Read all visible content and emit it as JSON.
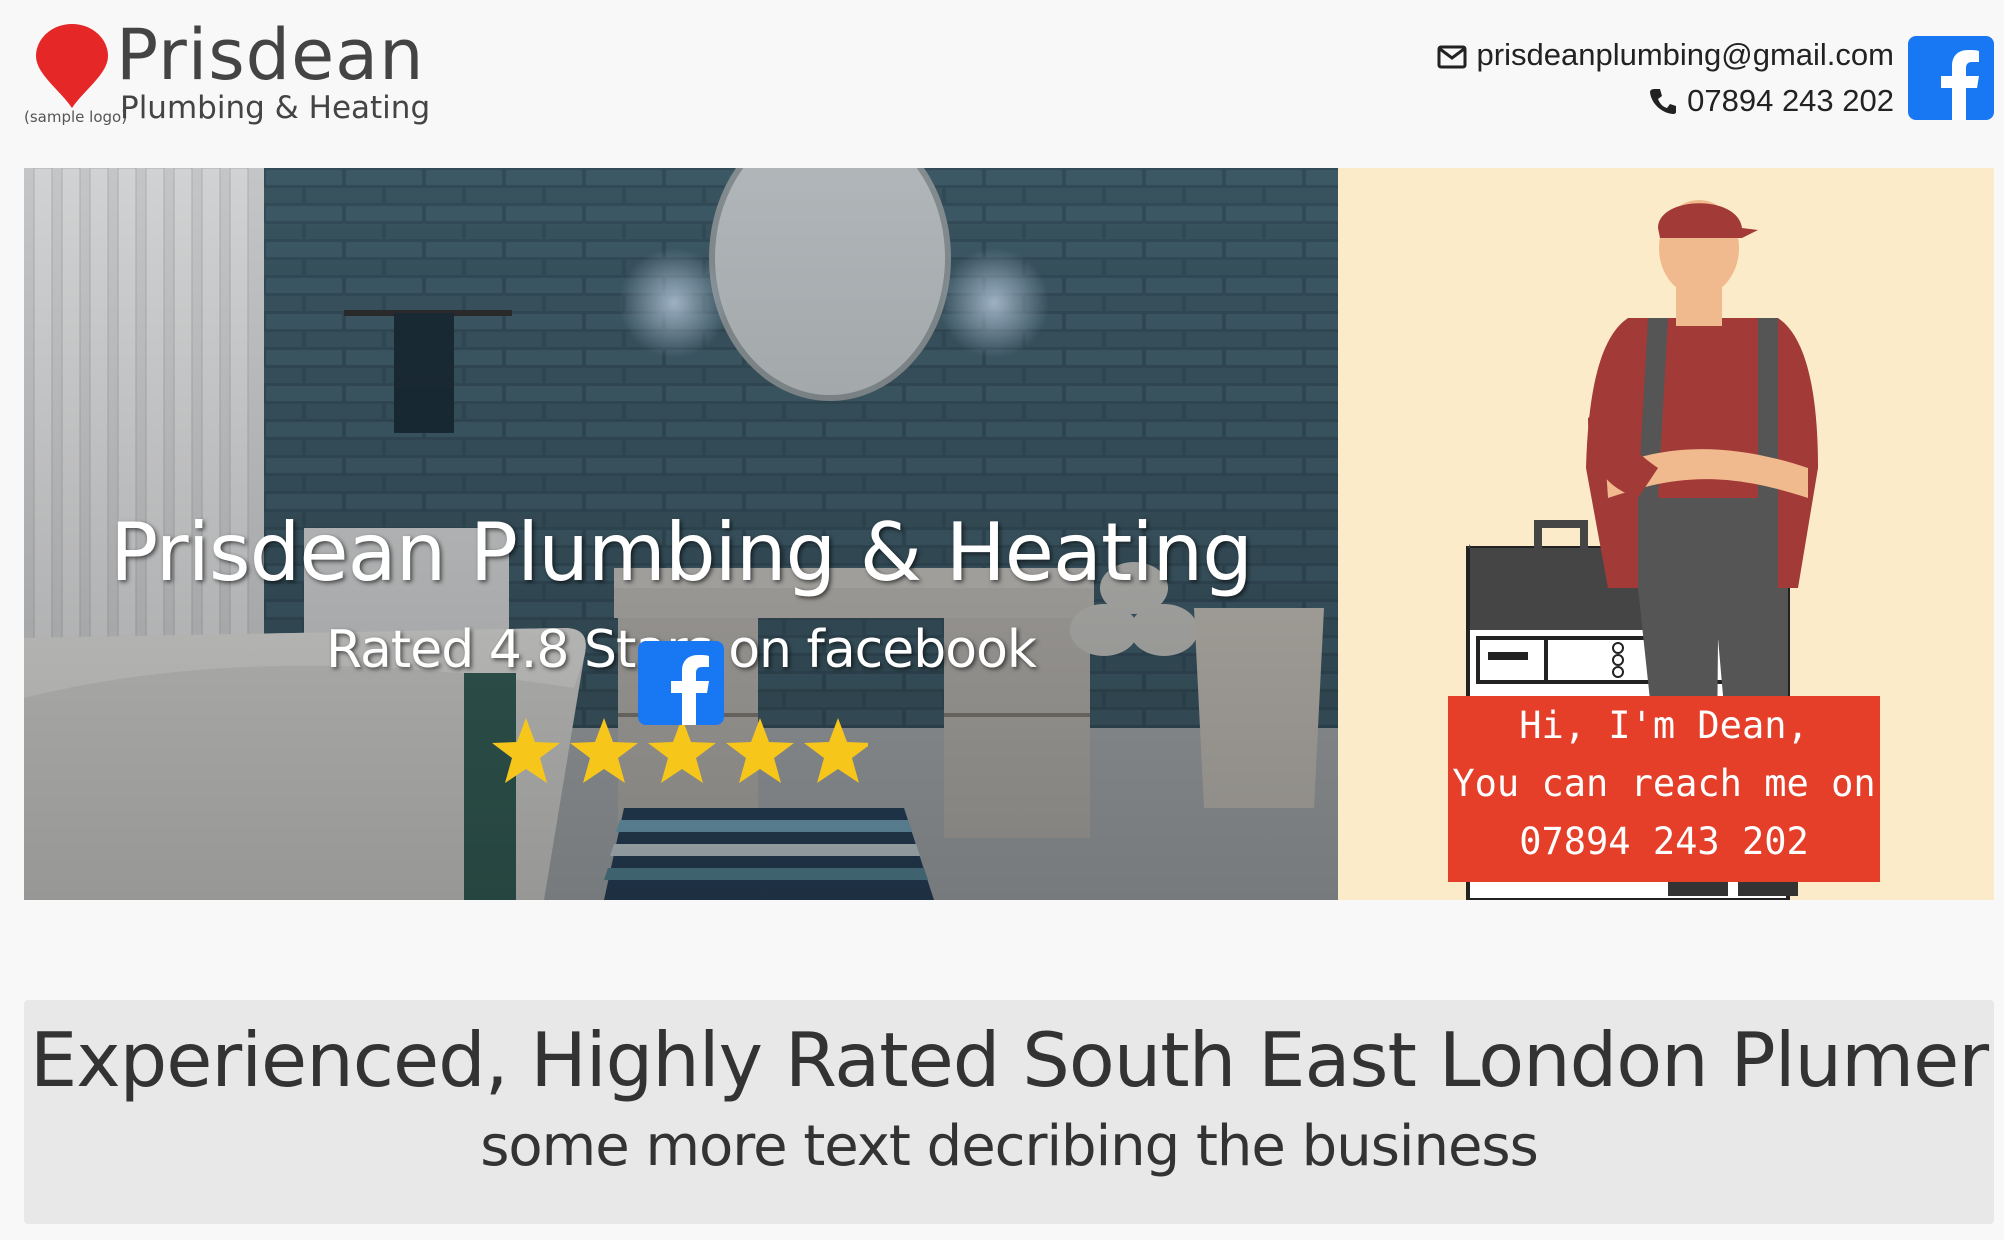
{
  "brand": {
    "name": "Prisdean",
    "tagline": "Plumbing & Heating",
    "sample_note": "(sample logo)",
    "logo_color": "#e62727"
  },
  "contact": {
    "email": "prisdeanplumbing@gmail.com",
    "phone": "07894 243 202",
    "email_icon": "envelope-icon",
    "phone_icon": "phone-icon",
    "social_icon": "facebook-icon",
    "social_color": "#1877f2"
  },
  "hero": {
    "title": "Prisdean Plumbing & Heating",
    "subtitle": "Rated 4.8 Stars on facebook",
    "rating_stars": 5,
    "star_color": "#f7c61b",
    "star_icon": "star-icon",
    "social_icon": "facebook-icon"
  },
  "promo": {
    "line1": "Hi, I'm Dean,",
    "line2": "You can reach me on",
    "line3": "07894 243 202",
    "badge_color": "#e53f2a",
    "background": "#fcebc8"
  },
  "about": {
    "headline": "Experienced, Highly Rated South East London Plumer",
    "description": "some more text decribing the business"
  }
}
